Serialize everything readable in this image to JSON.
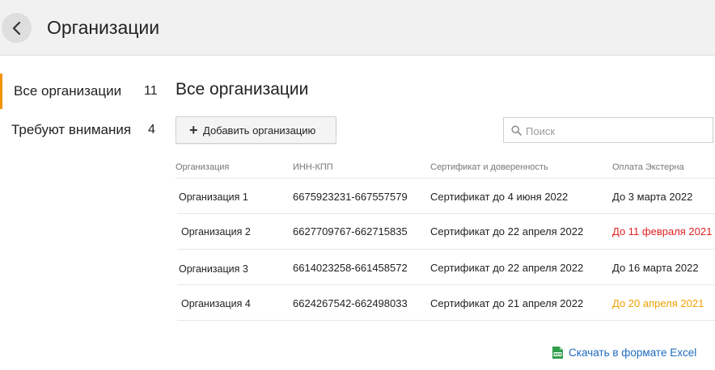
{
  "header": {
    "title": "Организации"
  },
  "sidebar": {
    "items": [
      {
        "label": "Все организации",
        "count": "11"
      },
      {
        "label": "Требуют внимания",
        "count": "4"
      }
    ]
  },
  "main": {
    "title": "Все организации",
    "add_button_label": "Добавить организацию",
    "search": {
      "placeholder": "Поиск",
      "value": ""
    },
    "columns": [
      "Организация",
      "ИНН-КПП",
      "Сертификат и доверенность",
      "Оплата Экстерна"
    ],
    "rows": [
      {
        "name": "Организация 1",
        "inn": "6675923231-667557579",
        "cert": "Сертификат до 4 июня 2022",
        "payment": "До 3 марта 2022",
        "payment_status": "normal"
      },
      {
        "name": "Организация 2",
        "inn": "6627709767-662715835",
        "cert": "Сертификат до 22 апреля 2022",
        "payment": "До 11 февраля 2021",
        "payment_status": "expired"
      },
      {
        "name": "Организация 3",
        "inn": "6614023258-661458572",
        "cert": "Сертификат до 22 апреля 2022",
        "payment": "До 16 марта 2022",
        "payment_status": "normal"
      },
      {
        "name": "Организация 4",
        "inn": "6624267542-662498033",
        "cert": "Сертификат до 21 апреля 2022",
        "payment": "До 20 апреля 2021",
        "payment_status": "warning"
      }
    ],
    "export_label": "Скачать в формате Excel"
  },
  "colors": {
    "accent": "#f29400",
    "link": "#1d6bbf",
    "expired": "#e02020",
    "warning": "#f0a000",
    "normal": "#222222"
  },
  "icons": {
    "back": "chevron-left-icon",
    "add": "plus-icon",
    "search": "search-icon",
    "export": "excel-icon"
  }
}
